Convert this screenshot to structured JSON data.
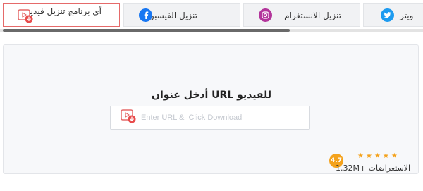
{
  "tabs": [
    {
      "label": "أي برنامج تنزيل فيديو",
      "icon": "video-download-icon",
      "selected": true
    },
    {
      "label": "تنزيل الفيسبوك",
      "icon": "facebook-icon",
      "selected": false,
      "color": "#1877f2"
    },
    {
      "label": "تنزيل الانستغرام",
      "icon": "instagram-icon",
      "selected": false,
      "color": "#b3359b"
    },
    {
      "label": "ويتر",
      "icon": "twitter-icon",
      "selected": false,
      "color": "#1d9bf0"
    }
  ],
  "main": {
    "heading": "للفيديو URL أدخل عنوان",
    "url_placeholder": "Enter URL &  Click Download",
    "url_value": ""
  },
  "rating": {
    "score": "4.7",
    "stars": 5,
    "reviews_text": "الاستعراضات +1.32M"
  },
  "colors": {
    "accent": "#e56a6a",
    "star": "#f4a21c",
    "badge": "#f4a21c"
  }
}
